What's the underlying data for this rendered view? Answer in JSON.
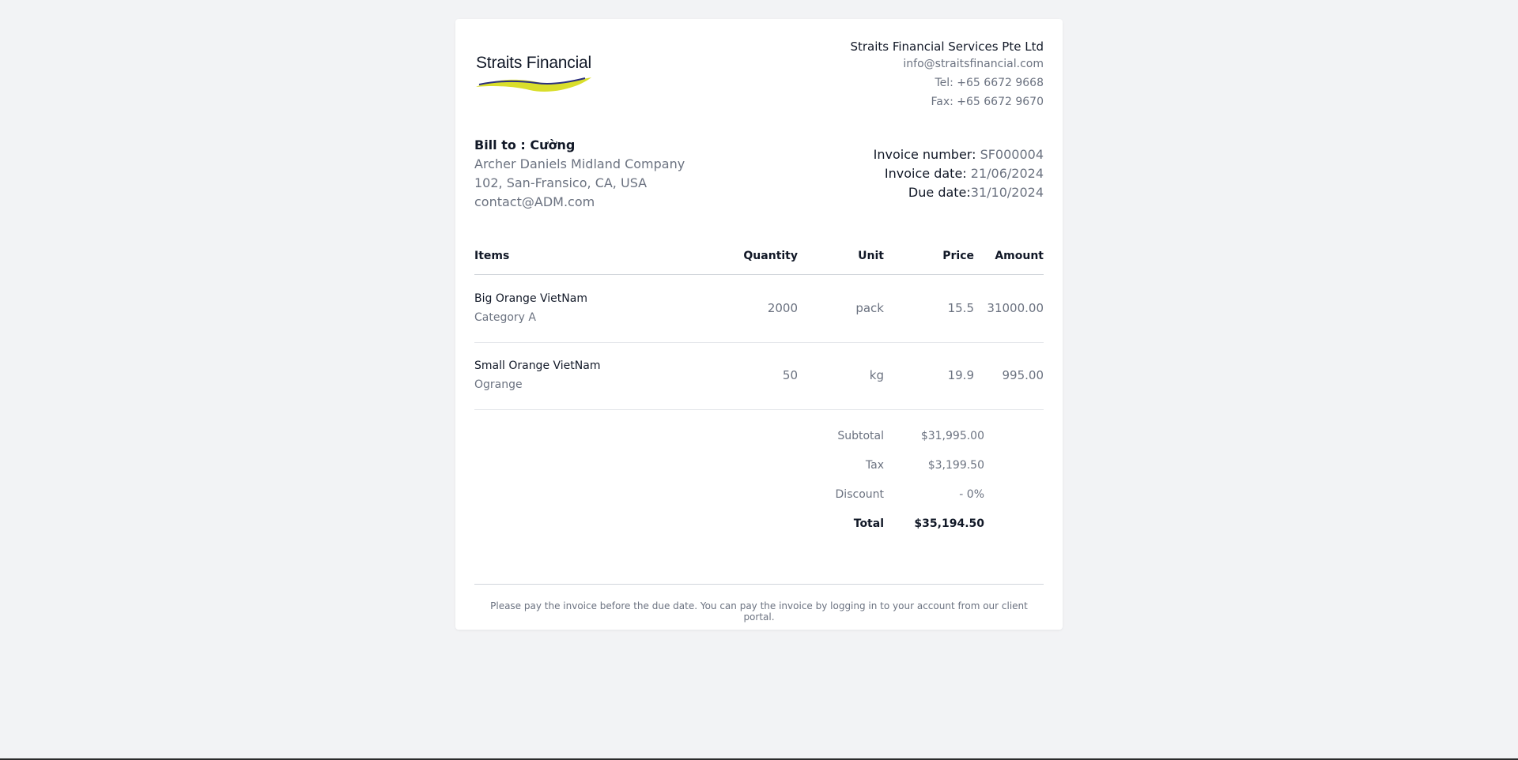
{
  "brand": {
    "logo_text": "Straits Financial",
    "accent": "#d9de2b",
    "navy": "#2b2f80"
  },
  "company": {
    "name": "Straits Financial Services Pte Ltd",
    "email": "info@straitsfinancial.com",
    "tel": "Tel: +65 6672 9668",
    "fax": "Fax: +65 6672 9670"
  },
  "bill_to": {
    "heading": "Bill to : Cường",
    "company": "Archer Daniels Midland Company",
    "address": "102, San-Fransico, CA, USA",
    "email": "contact@ADM.com"
  },
  "invoice": {
    "number_label": "Invoice number:",
    "number": "SF000004",
    "date_label": "Invoice date:",
    "date": "21/06/2024",
    "due_label": "Due date:",
    "due": "31/10/2024"
  },
  "table": {
    "headers": {
      "items": "Items",
      "quantity": "Quantity",
      "unit": "Unit",
      "price": "Price",
      "amount": "Amount"
    },
    "rows": [
      {
        "name": "Big Orange VietNam",
        "category": "Category A",
        "quantity": "2000",
        "unit": "pack",
        "price": "15.5",
        "amount": "31000.00"
      },
      {
        "name": "Small Orange VietNam",
        "category": "Ogrange",
        "quantity": "50",
        "unit": "kg",
        "price": "19.9",
        "amount": "995.00"
      }
    ]
  },
  "totals": {
    "subtotal_label": "Subtotal",
    "subtotal": "$31,995.00",
    "tax_label": "Tax",
    "tax": "$3,199.50",
    "discount_label": "Discount",
    "discount": "- 0%",
    "total_label": "Total",
    "total": "$35,194.50"
  },
  "footer": {
    "note": "Please pay the invoice before the due date. You can pay the invoice by logging in to your account from our client portal."
  }
}
